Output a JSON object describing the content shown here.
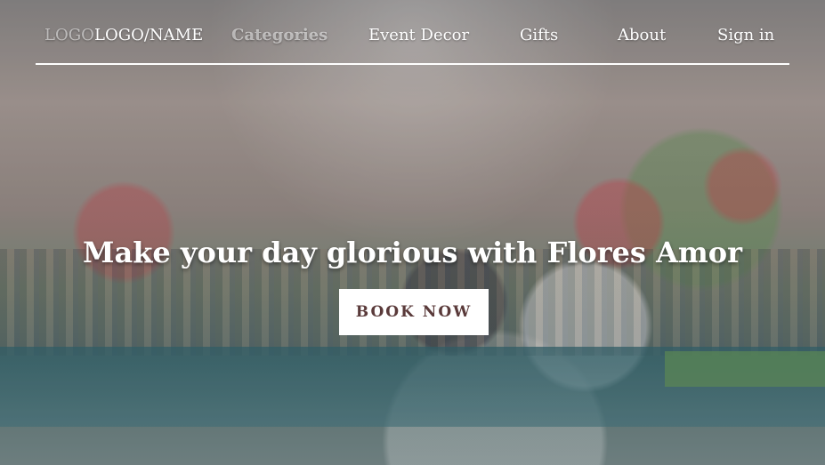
{
  "nav": {
    "logo_ghost": "LOGO",
    "logo": "LOGO/NAME",
    "categories": "Categories",
    "items": [
      {
        "label": "Event Decor"
      },
      {
        "label": "Gifts"
      },
      {
        "label": "About"
      },
      {
        "label": "Sign in"
      }
    ]
  },
  "hero": {
    "title": "Make your day glorious with Flores Amor",
    "cta": "BOOK NOW"
  },
  "colors": {
    "button_text": "#5a3a3a",
    "button_bg": "#ffffff",
    "nav_text": "#ffffff"
  }
}
